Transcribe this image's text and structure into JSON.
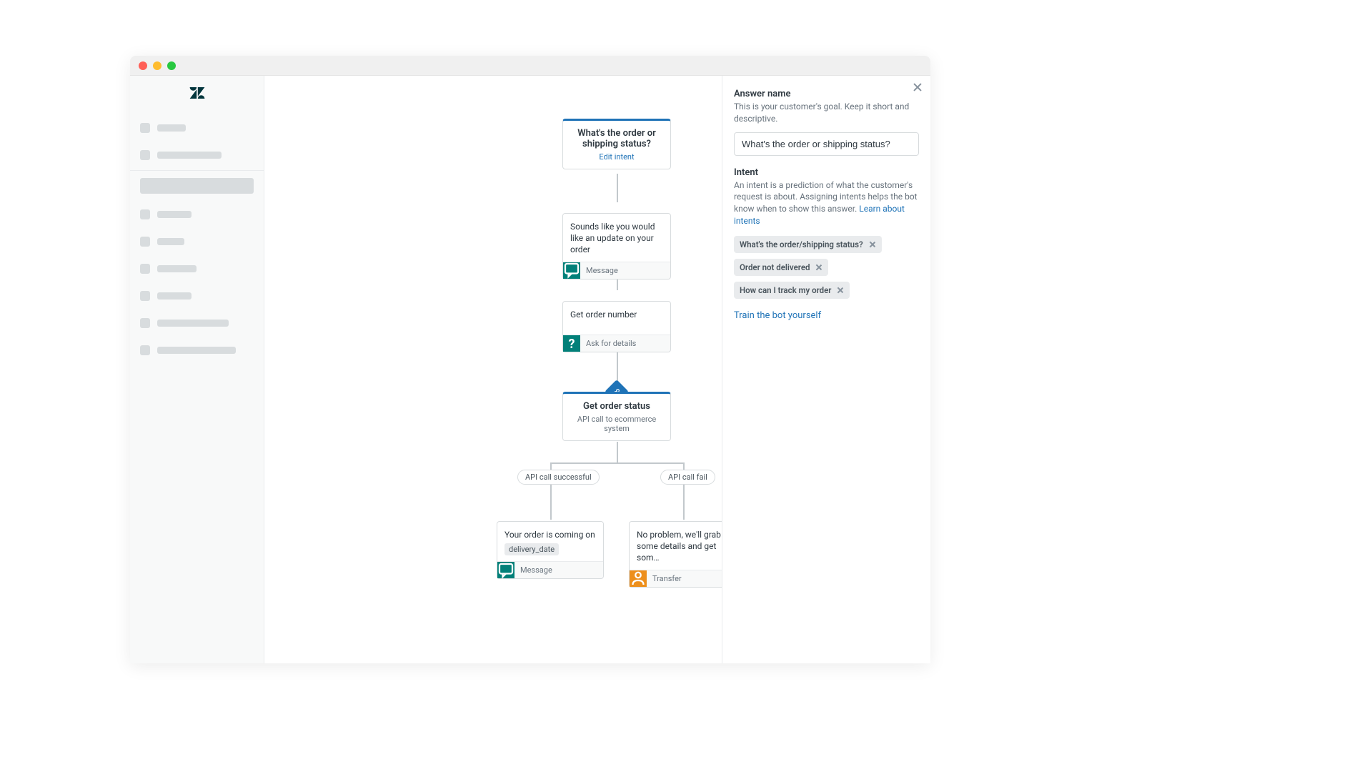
{
  "flow": {
    "start": {
      "title": "What's the order or shipping status?",
      "edit_link": "Edit intent"
    },
    "message1": {
      "text": "Sounds like you would like an update on your order",
      "footer": "Message"
    },
    "ask1": {
      "text": "Get order number",
      "footer": "Ask for details"
    },
    "api": {
      "title": "Get order status",
      "subtitle": "API call to ecommerce system"
    },
    "branch_success": "API call successful",
    "branch_fail": "API call fail",
    "leaf_success": {
      "text": "Your order is coming on",
      "tag": "delivery_date",
      "footer": "Message"
    },
    "leaf_fail": {
      "text": "No problem, we'll grab some details and get som…",
      "footer": "Transfer"
    }
  },
  "panel": {
    "answer_name_label": "Answer name",
    "answer_name_help": "This is your customer's goal. Keep it short and descriptive.",
    "answer_name_value": "What's the order or shipping status?",
    "intent_label": "Intent",
    "intent_help": "An intent is a prediction of what the customer's request is about. Assigning intents helps the bot know when to show this answer. ",
    "intent_link": "Learn about intents",
    "chips": [
      "What's the order/shipping status?",
      "Order not delivered",
      "How can I track my order"
    ],
    "train_link": "Train the bot yourself"
  }
}
